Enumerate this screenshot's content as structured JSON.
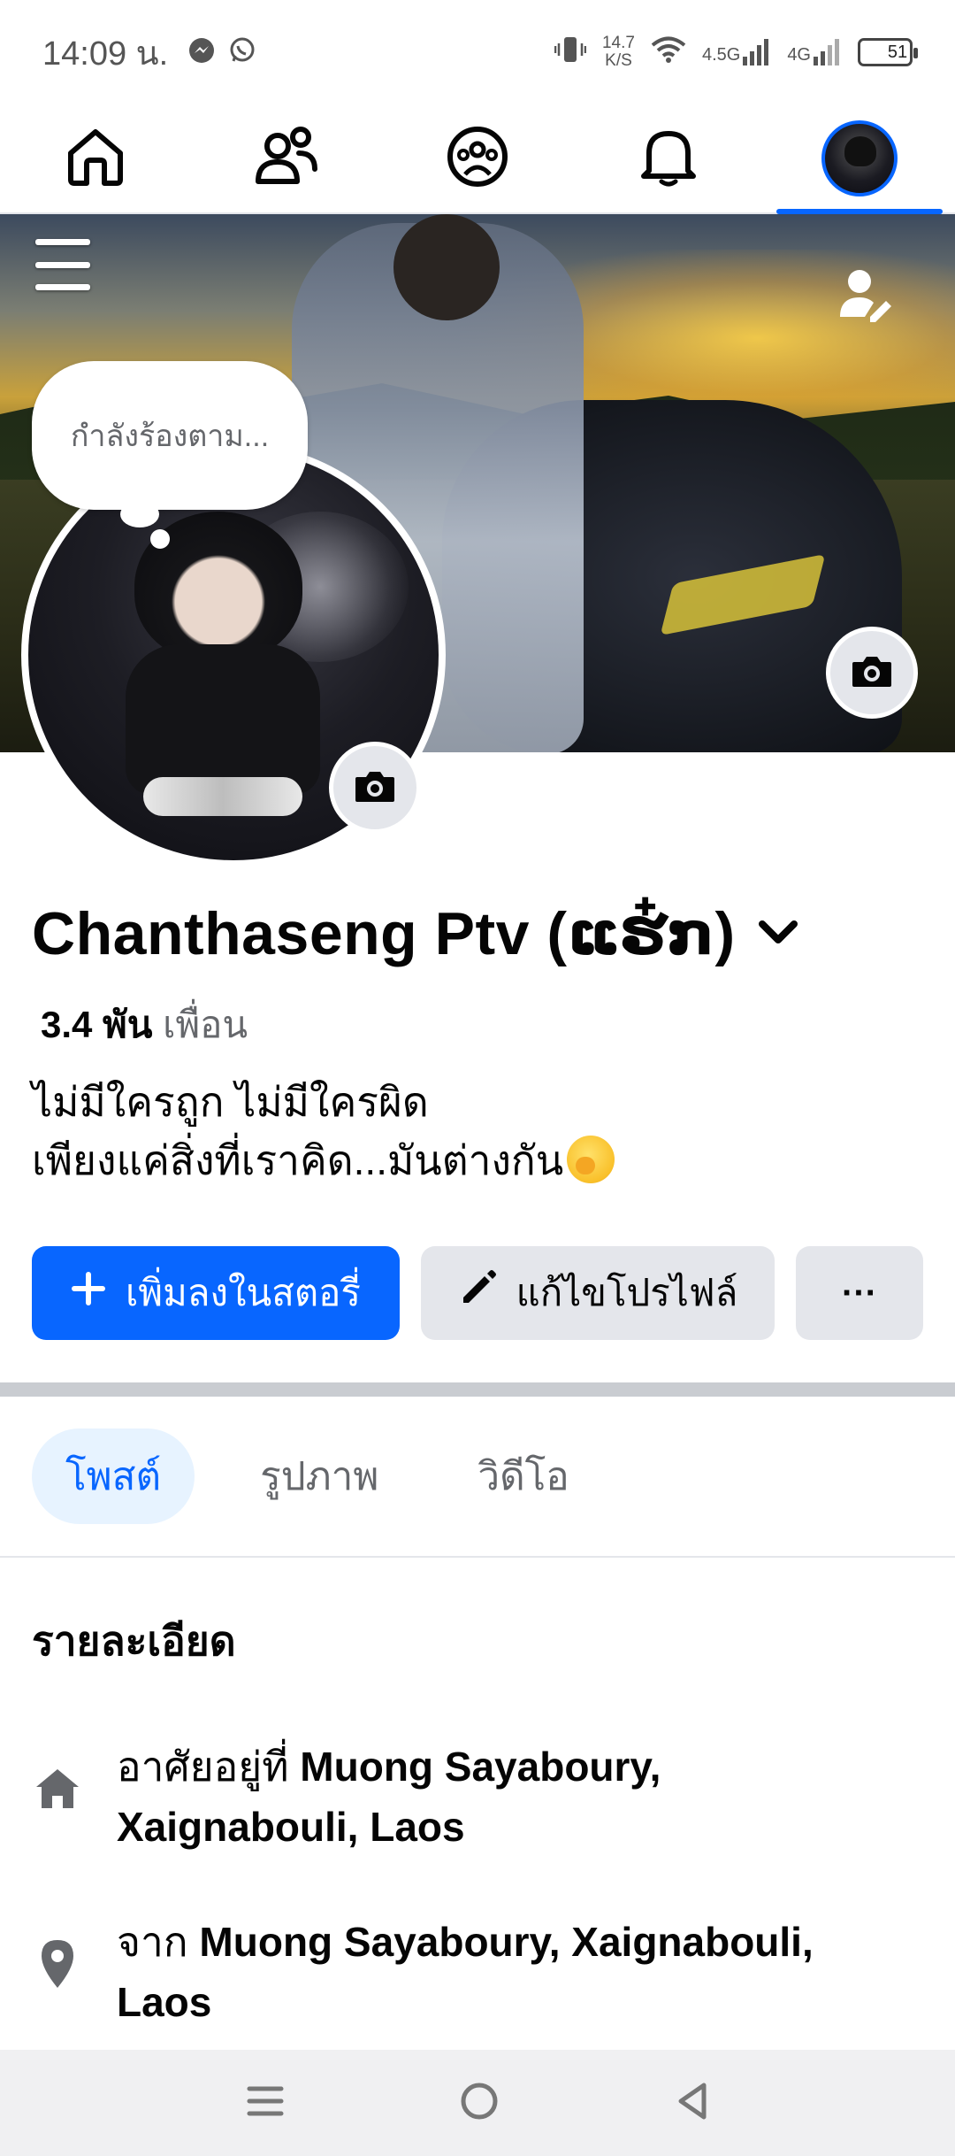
{
  "status_bar": {
    "time": "14:09 น.",
    "net_speed_value": "14.7",
    "net_speed_unit": "K/S",
    "signal_1": "4.5G",
    "signal_2": "4G",
    "battery": "51"
  },
  "nav": {
    "tabs": [
      "home",
      "friends",
      "groups",
      "notifications",
      "profile"
    ],
    "active": "profile"
  },
  "profile": {
    "thought_bubble": "กำลังร้องตาม...",
    "name": "Chanthaseng Ptv (ແຮ໋ກ)",
    "friends_count": "3.4 พัน",
    "friends_label": "เพื่อน",
    "bio_line_1": "ไม่มีใครถูก ไม่มีใครผิด",
    "bio_line_2": "เพียงแค่สิ่งที่เราคิด...มันต่างกัน"
  },
  "actions": {
    "add_story": "เพิ่มลงในสตอรี่",
    "edit_profile": "แก้ไขโปรไฟล์",
    "more": "···"
  },
  "content_tabs": [
    {
      "label": "โพสต์",
      "active": true
    },
    {
      "label": "รูปภาพ",
      "active": false
    },
    {
      "label": "วิดีโอ",
      "active": false
    }
  ],
  "details": {
    "title": "รายละเอียด",
    "lives_prefix": "อาศัยอยู่ที่",
    "lives_place_1": "Muong Sayaboury,",
    "lives_place_2": "Xaignabouli, Laos",
    "from_prefix": "จาก",
    "from_place_1": "Muong Sayaboury, Xaignabouli,",
    "from_place_2": "Laos"
  },
  "colors": {
    "accent": "#0866ff",
    "secondary_button": "#e4e6eb",
    "muted_text": "#65676b"
  },
  "icons": {
    "nav": [
      "home-icon",
      "friends-icon",
      "groups-icon",
      "bell-icon",
      "profile-avatar"
    ],
    "cover": [
      "menu-icon",
      "person-edit-icon",
      "camera-icon"
    ],
    "details": [
      "house-icon",
      "location-pin-icon"
    ],
    "system_nav": [
      "recents-icon",
      "home-circle-icon",
      "back-icon"
    ]
  }
}
